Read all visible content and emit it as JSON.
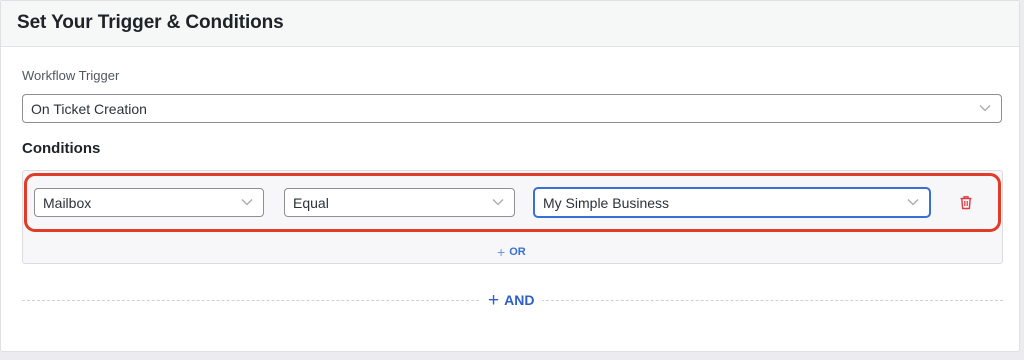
{
  "header": {
    "title": "Set Your Trigger & Conditions"
  },
  "trigger": {
    "label": "Workflow Trigger",
    "selected": "On Ticket Creation"
  },
  "conditions": {
    "title": "Conditions",
    "rows": [
      {
        "field": "Mailbox",
        "operator": "Equal",
        "value": "My Simple Business"
      }
    ],
    "or_label": "OR",
    "or_plus": "+",
    "and_label": "AND",
    "and_plus": "+"
  },
  "colors": {
    "highlight": "#e03c28",
    "accent": "#3a6fd8",
    "delete": "#e0393e"
  },
  "icons": {
    "dropdown": "chevron-down-icon",
    "delete": "trash-icon"
  }
}
